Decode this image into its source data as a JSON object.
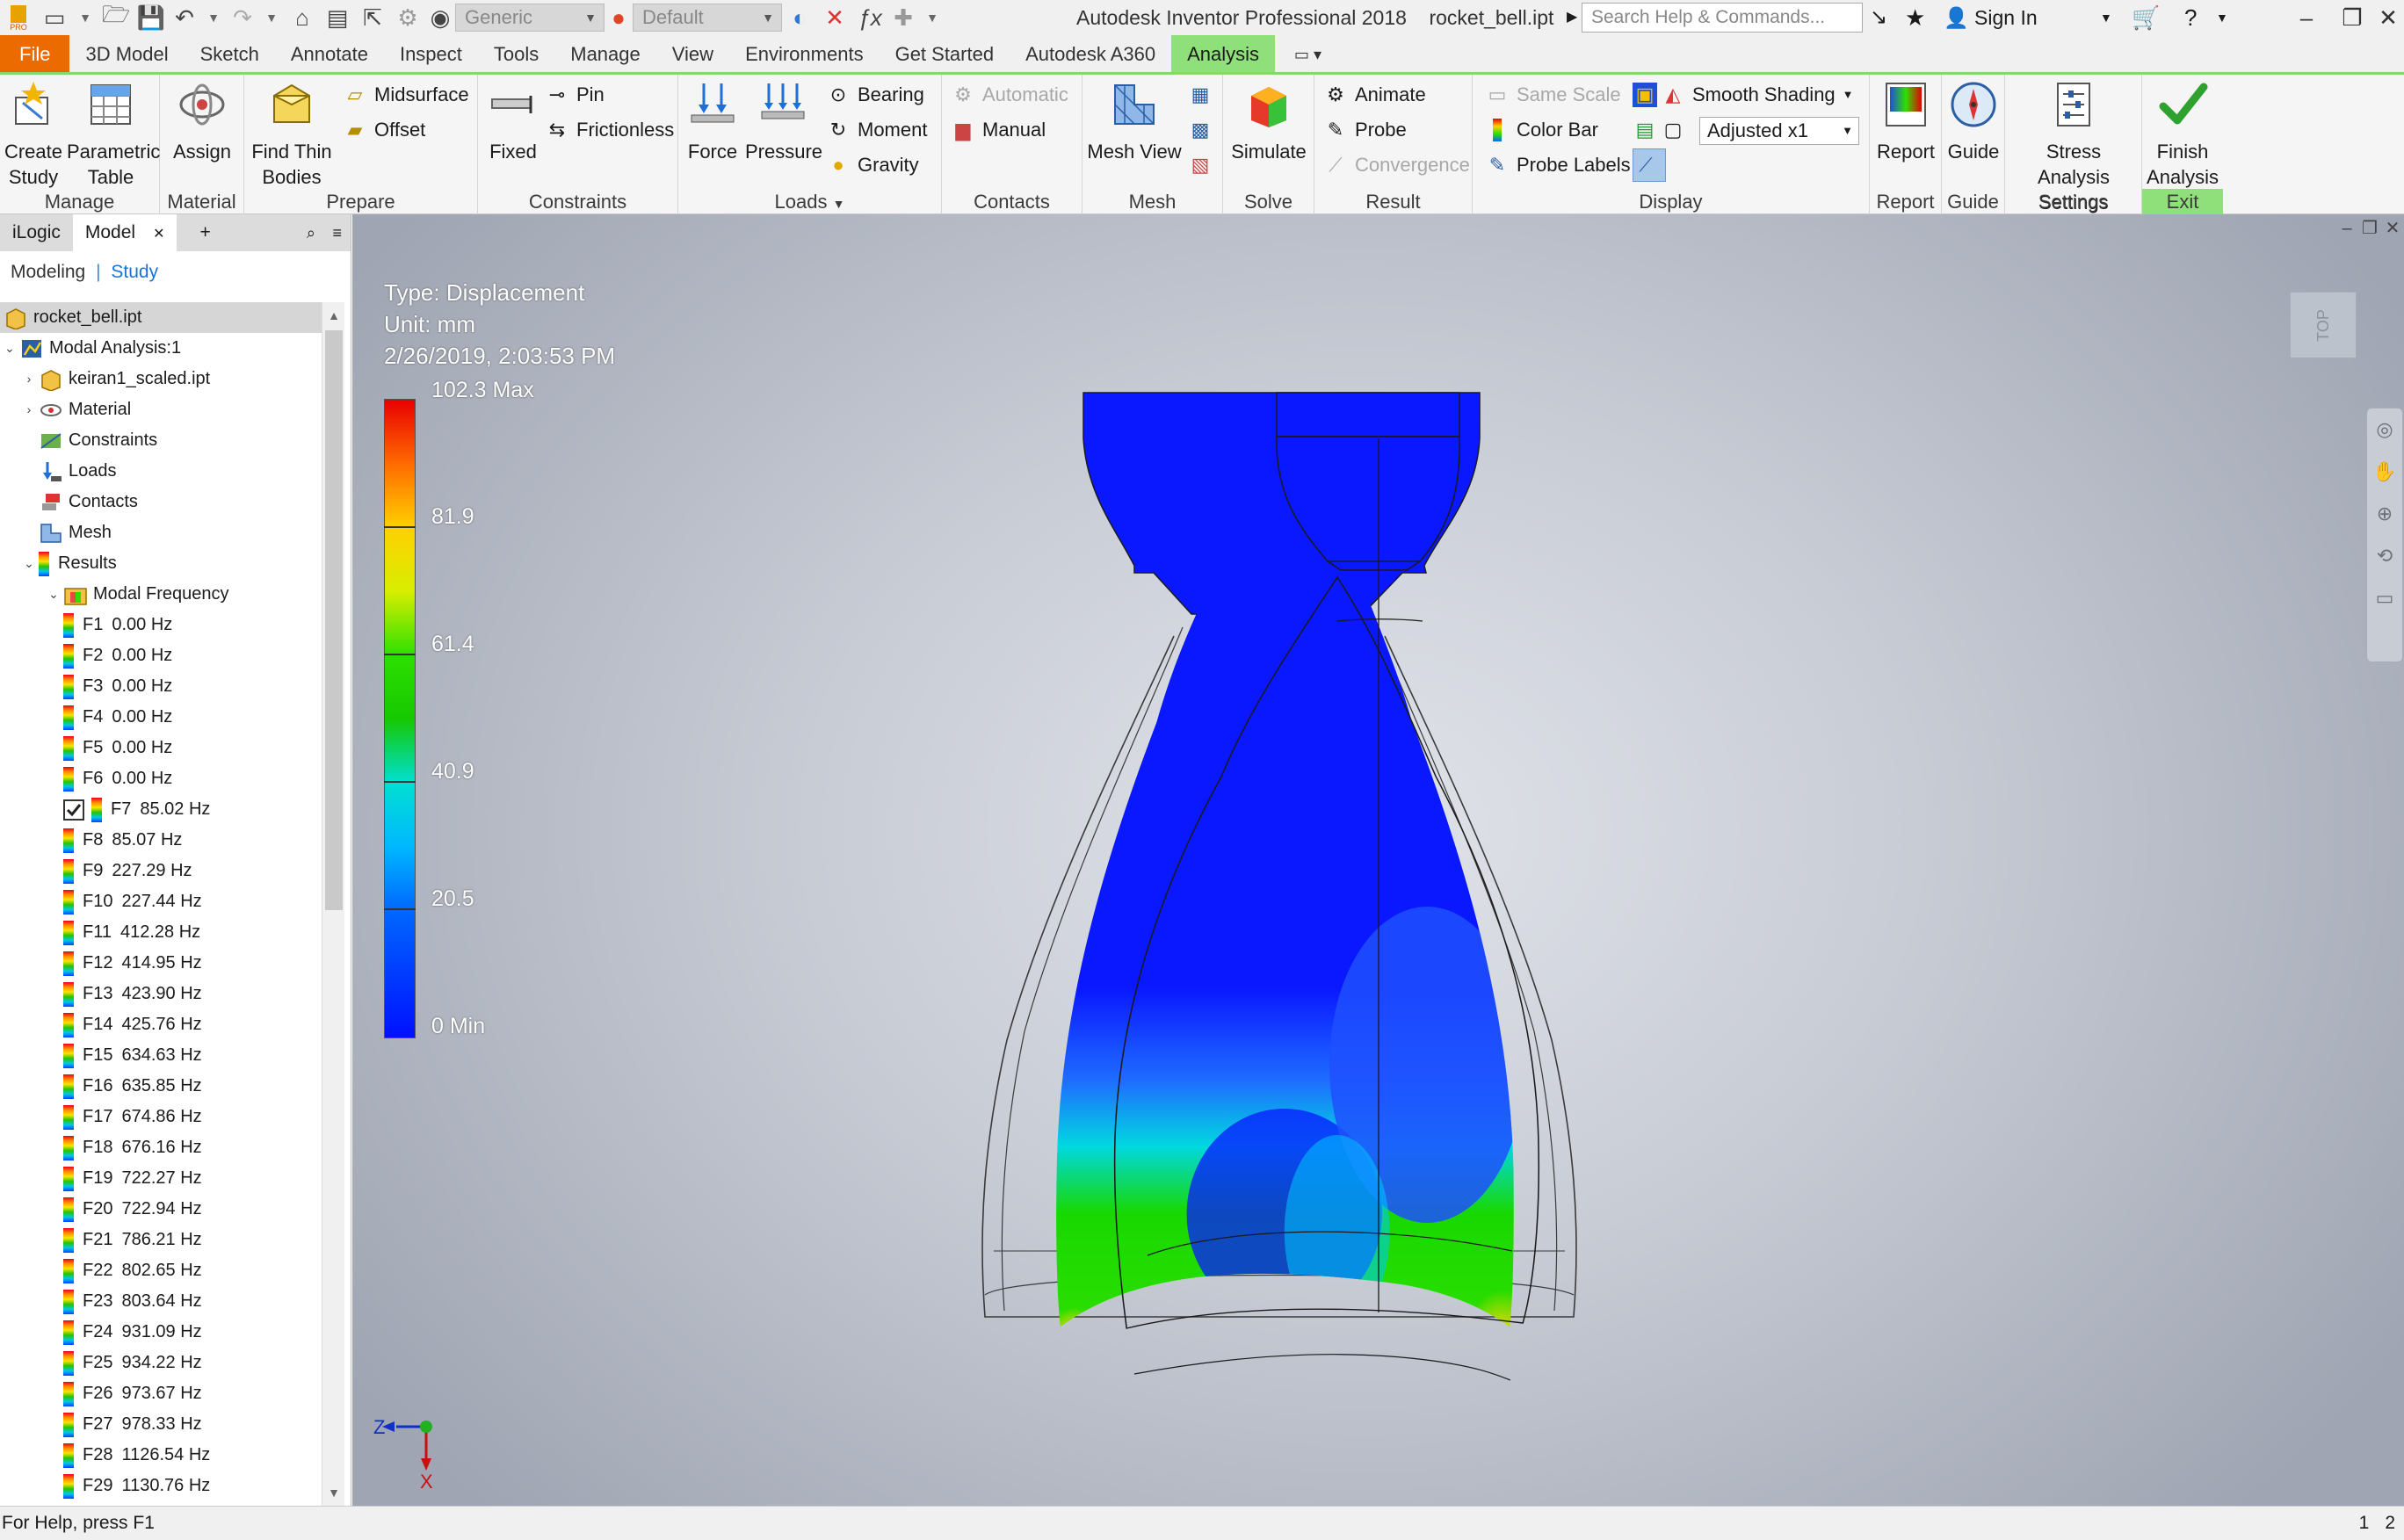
{
  "titlebar": {
    "app_title": "Autodesk Inventor Professional 2018",
    "file_name": "rocket_bell.ipt",
    "appearance_combo": "Generic",
    "material_combo": "Default",
    "search_placeholder": "Search Help & Commands...",
    "sign_in": "Sign In"
  },
  "tabs": [
    "File",
    "3D Model",
    "Sketch",
    "Annotate",
    "Inspect",
    "Tools",
    "Manage",
    "View",
    "Environments",
    "Get Started",
    "Autodesk A360",
    "Analysis"
  ],
  "active_tab": "Analysis",
  "ribbon": {
    "manage": {
      "title": "Manage",
      "create_study": "Create\nStudy",
      "parametric_table": "Parametric\nTable"
    },
    "material": {
      "title": "Material",
      "assign": "Assign"
    },
    "prepare": {
      "title": "Prepare",
      "find_thin_bodies": "Find Thin\nBodies",
      "midsurface": "Midsurface",
      "offset": "Offset"
    },
    "constraints": {
      "title": "Constraints",
      "fixed": "Fixed",
      "pin": "Pin",
      "frictionless": "Frictionless"
    },
    "loads": {
      "title": "Loads",
      "force": "Force",
      "pressure": "Pressure",
      "bearing": "Bearing",
      "moment": "Moment",
      "gravity": "Gravity"
    },
    "contacts": {
      "title": "Contacts",
      "automatic": "Automatic",
      "manual": "Manual"
    },
    "mesh": {
      "title": "Mesh",
      "mesh_view": "Mesh View"
    },
    "solve": {
      "title": "Solve",
      "simulate": "Simulate"
    },
    "result": {
      "title": "Result",
      "animate": "Animate",
      "probe": "Probe",
      "convergence": "Convergence"
    },
    "display": {
      "title": "Display",
      "same_scale": "Same Scale",
      "color_bar": "Color Bar",
      "probe_labels": "Probe Labels",
      "shading": "Smooth Shading",
      "adjust": "Adjusted x1"
    },
    "report": {
      "title": "Report",
      "report": "Report"
    },
    "guide": {
      "title": "Guide",
      "guide": "Guide"
    },
    "settings": {
      "title": "Settings",
      "stress_settings": "Stress Analysis\nSettings"
    },
    "exit": {
      "title": "Exit",
      "finish": "Finish\nAnalysis"
    }
  },
  "browser": {
    "tabs": [
      "iLogic",
      "Model"
    ],
    "active_tab": "Model",
    "add_tab": "+",
    "modeling": "Modeling",
    "study": "Study",
    "root": "rocket_bell.ipt",
    "analysis": "Modal Analysis:1",
    "nodes": [
      "keiran1_scaled.ipt",
      "Material",
      "Constraints",
      "Loads",
      "Contacts",
      "Mesh",
      "Results"
    ],
    "modal_frequency": "Modal Frequency",
    "frequencies": [
      {
        "id": "F1",
        "value": "0.00 Hz"
      },
      {
        "id": "F2",
        "value": "0.00 Hz"
      },
      {
        "id": "F3",
        "value": "0.00 Hz"
      },
      {
        "id": "F4",
        "value": "0.00 Hz"
      },
      {
        "id": "F5",
        "value": "0.00 Hz"
      },
      {
        "id": "F6",
        "value": "0.00 Hz"
      },
      {
        "id": "F7",
        "value": "85.02 Hz",
        "checked": true
      },
      {
        "id": "F8",
        "value": "85.07 Hz"
      },
      {
        "id": "F9",
        "value": "227.29 Hz"
      },
      {
        "id": "F10",
        "value": "227.44 Hz"
      },
      {
        "id": "F11",
        "value": "412.28 Hz"
      },
      {
        "id": "F12",
        "value": "414.95 Hz"
      },
      {
        "id": "F13",
        "value": "423.90 Hz"
      },
      {
        "id": "F14",
        "value": "425.76 Hz"
      },
      {
        "id": "F15",
        "value": "634.63 Hz"
      },
      {
        "id": "F16",
        "value": "635.85 Hz"
      },
      {
        "id": "F17",
        "value": "674.86 Hz"
      },
      {
        "id": "F18",
        "value": "676.16 Hz"
      },
      {
        "id": "F19",
        "value": "722.27 Hz"
      },
      {
        "id": "F20",
        "value": "722.94 Hz"
      },
      {
        "id": "F21",
        "value": "786.21 Hz"
      },
      {
        "id": "F22",
        "value": "802.65 Hz"
      },
      {
        "id": "F23",
        "value": "803.64 Hz"
      },
      {
        "id": "F24",
        "value": "931.09 Hz"
      },
      {
        "id": "F25",
        "value": "934.22 Hz"
      },
      {
        "id": "F26",
        "value": "973.67 Hz"
      },
      {
        "id": "F27",
        "value": "978.33 Hz"
      },
      {
        "id": "F28",
        "value": "1126.54 Hz"
      },
      {
        "id": "F29",
        "value": "1130.76 Hz"
      }
    ]
  },
  "viewport": {
    "type": "Type: Displacement",
    "unit": "Unit: mm",
    "datetime": "2/26/2019, 2:03:53 PM",
    "colorbar_labels": [
      "102.3 Max",
      "81.9",
      "61.4",
      "40.9",
      "20.5",
      "0 Min"
    ],
    "viewcube_label": "TOP",
    "axis_z": "Z",
    "axis_x": "X"
  },
  "statusbar": {
    "help": "For Help, press F1",
    "page1": "1",
    "page2": "2"
  }
}
